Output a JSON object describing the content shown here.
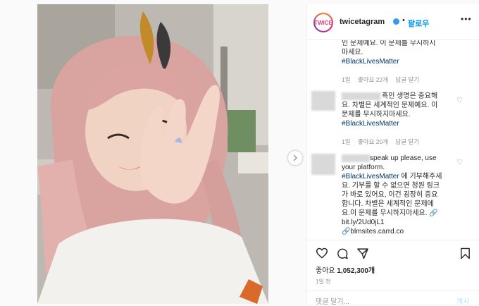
{
  "header": {
    "username": "twicetagram",
    "separator": "•",
    "follow_label": "팔로우",
    "more_label": "•••",
    "avatar_text": "TWICE"
  },
  "comments": [
    {
      "lines": [
        "인 문제예요. 이 문제를 무시하지",
        "마세요."
      ],
      "hashtag": "#BlackLivesMatter",
      "time": "1일",
      "likes": "좋아요 22개",
      "reply": "답글 달기"
    },
    {
      "username_tail": "흑인 생명은 중요해",
      "lines": [
        "요. 차별은 세계적인 문제예요. 이",
        "문제를 무시하지마세요."
      ],
      "hashtag": "#BlackLivesMatter",
      "time": "1일",
      "likes": "좋아요 20개",
      "reply": "답글 달기"
    },
    {
      "first_line": "speak up please, use",
      "lines_before": [
        "your platform."
      ],
      "hashtag": "#BlackLivesMatter",
      "hashtag_tail": " 에 기부해주세",
      "lines": [
        "요. 기부를 할 수 없으면 청원 링크",
        "가 바로 있어요, 이건 굉장히 중요",
        "합니다. 차별은 세계적인 문제에",
        "요.이 문제를 무시하지마세요."
      ],
      "link1": "bit.ly/2Ud0jL1",
      "link2": "blmsites.carrd.co"
    }
  ],
  "actions": {
    "likes_label": "좋아요",
    "likes_count": "1,052,300개",
    "time": "1일 전",
    "comment_placeholder": "댓글 달기...",
    "post_label": "게시"
  },
  "colors": {
    "accent": "#0095f6",
    "hashtag": "#003569",
    "muted": "#8e8e8e"
  }
}
